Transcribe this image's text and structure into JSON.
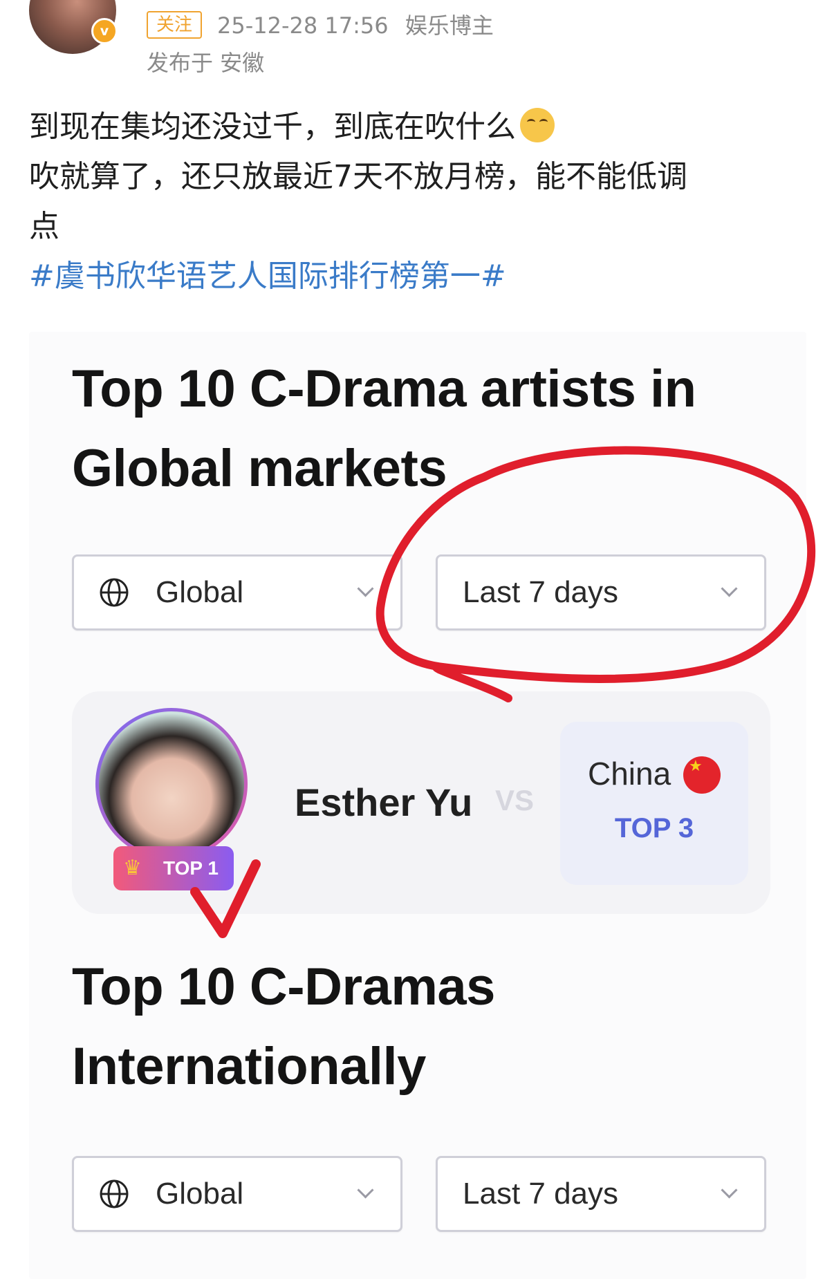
{
  "post": {
    "follow_label": "关注",
    "timestamp": "25-12-28 17:56",
    "account_type": "娱乐博主",
    "location": "发布于 安徽",
    "lines": [
      "到现在集均还没过千，到底在吹什么",
      "吹就算了，还只放最近7天不放月榜，能不能低调",
      "点"
    ],
    "hashtag": "#虞书欣华语艺人国际排行榜第一#"
  },
  "image": {
    "section1": {
      "title_line1": "Top 10 C-Drama artists in",
      "title_line2": "Global markets",
      "region_select": "Global",
      "period_select": "Last 7 days"
    },
    "artist_card": {
      "badge": "TOP 1",
      "name": "Esther Yu",
      "vs": "VS",
      "country": "China",
      "country_rank": "TOP 3"
    },
    "section2": {
      "title_line1": "Top 10 C-Dramas",
      "title_line2": "Internationally",
      "region_select": "Global",
      "period_select": "Last 7 days"
    }
  },
  "colors": {
    "follow_orange": "#f0a32f",
    "hashtag_blue": "#3a7bc8",
    "rank_blue": "#5566d8",
    "annotation_red": "#e01e2c"
  }
}
